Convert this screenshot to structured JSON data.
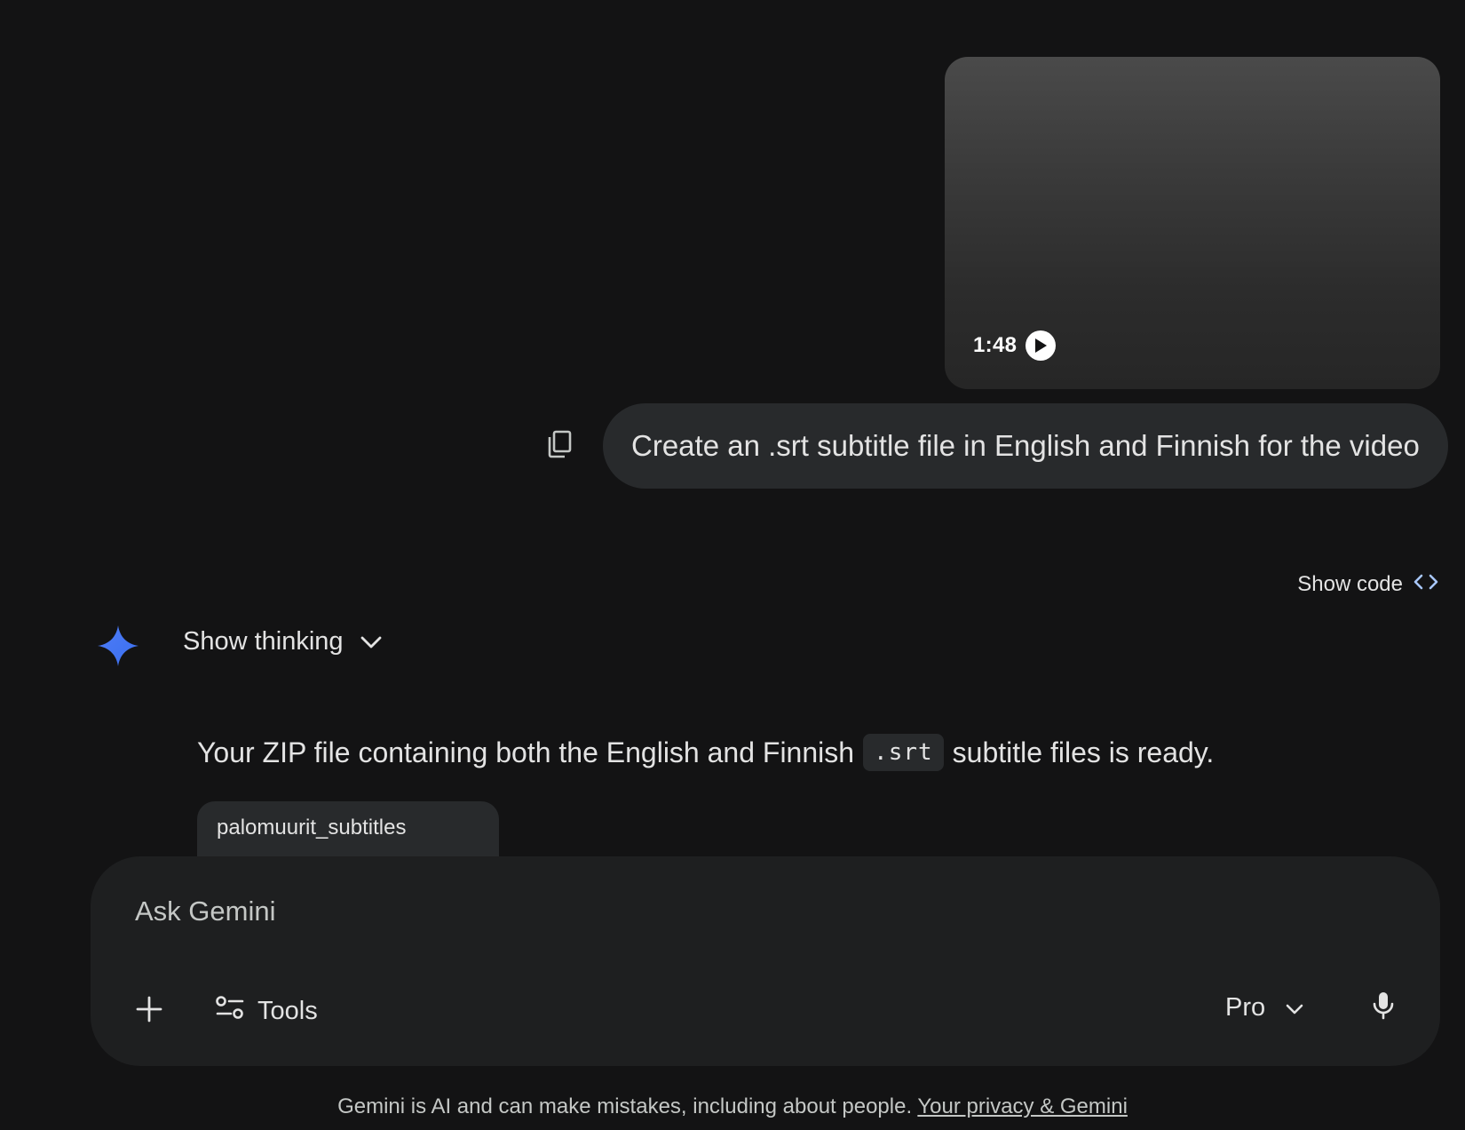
{
  "video": {
    "duration": "1:48",
    "play_icon": "play-icon"
  },
  "prompt": {
    "text": "Create an .srt subtitle file in English and Finnish for the video",
    "copy_icon": "copy-icon"
  },
  "show_code": {
    "label": "Show code",
    "icon": "code-brackets-icon"
  },
  "thinking": {
    "label": "Show thinking",
    "icon": "chevron-down-icon"
  },
  "response": {
    "text_before": "Your ZIP file containing both the English and Finnish",
    "code": ".srt",
    "text_after": "subtitle files is ready."
  },
  "file": {
    "name": "palomuurit_subtitles"
  },
  "input": {
    "placeholder": "Ask Gemini",
    "value": "",
    "tools_label": "Tools",
    "model_label": "Pro"
  },
  "footer": {
    "disclaimer": "Gemini is AI and can make mistakes, including about people.",
    "link": "Your privacy & Gemini"
  },
  "colors": {
    "background": "#131314",
    "bubble": "#282a2c",
    "input_bg": "#1e1f20",
    "spark_blue": "#4285f4",
    "text": "#e3e3e3"
  }
}
